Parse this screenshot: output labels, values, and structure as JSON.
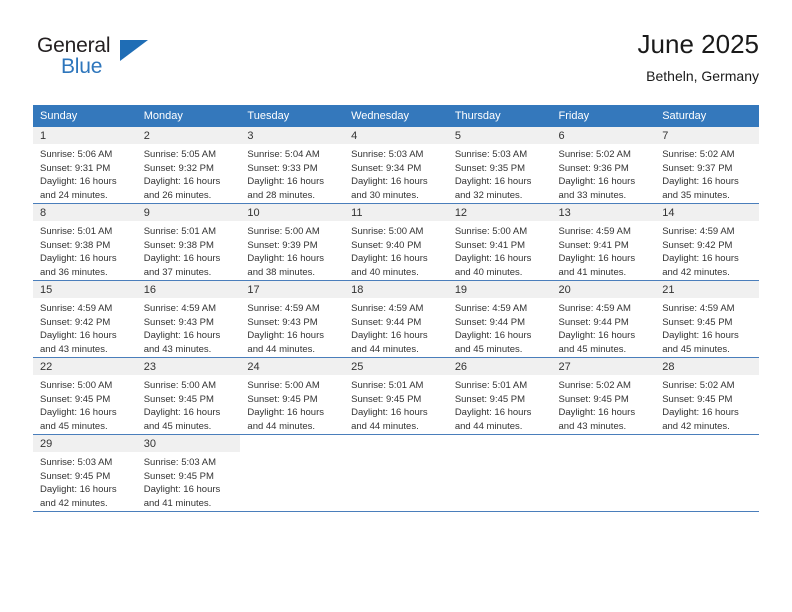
{
  "brand": {
    "word_top": "General",
    "word_bottom": "Blue",
    "triangle_color": "#1F6DB5"
  },
  "header": {
    "title": "June 2025",
    "location": "Betheln, Germany",
    "header_bg_color": "#3478BC",
    "header_text_color": "#FFFFFF"
  },
  "weekday_headers": [
    "Sunday",
    "Monday",
    "Tuesday",
    "Wednesday",
    "Thursday",
    "Friday",
    "Saturday"
  ],
  "weeks": [
    [
      {
        "day": "1",
        "sunrise": "Sunrise: 5:06 AM",
        "sunset": "Sunset: 9:31 PM",
        "daylight_line1": "Daylight: 16 hours",
        "daylight_line2": "and 24 minutes."
      },
      {
        "day": "2",
        "sunrise": "Sunrise: 5:05 AM",
        "sunset": "Sunset: 9:32 PM",
        "daylight_line1": "Daylight: 16 hours",
        "daylight_line2": "and 26 minutes."
      },
      {
        "day": "3",
        "sunrise": "Sunrise: 5:04 AM",
        "sunset": "Sunset: 9:33 PM",
        "daylight_line1": "Daylight: 16 hours",
        "daylight_line2": "and 28 minutes."
      },
      {
        "day": "4",
        "sunrise": "Sunrise: 5:03 AM",
        "sunset": "Sunset: 9:34 PM",
        "daylight_line1": "Daylight: 16 hours",
        "daylight_line2": "and 30 minutes."
      },
      {
        "day": "5",
        "sunrise": "Sunrise: 5:03 AM",
        "sunset": "Sunset: 9:35 PM",
        "daylight_line1": "Daylight: 16 hours",
        "daylight_line2": "and 32 minutes."
      },
      {
        "day": "6",
        "sunrise": "Sunrise: 5:02 AM",
        "sunset": "Sunset: 9:36 PM",
        "daylight_line1": "Daylight: 16 hours",
        "daylight_line2": "and 33 minutes."
      },
      {
        "day": "7",
        "sunrise": "Sunrise: 5:02 AM",
        "sunset": "Sunset: 9:37 PM",
        "daylight_line1": "Daylight: 16 hours",
        "daylight_line2": "and 35 minutes."
      }
    ],
    [
      {
        "day": "8",
        "sunrise": "Sunrise: 5:01 AM",
        "sunset": "Sunset: 9:38 PM",
        "daylight_line1": "Daylight: 16 hours",
        "daylight_line2": "and 36 minutes."
      },
      {
        "day": "9",
        "sunrise": "Sunrise: 5:01 AM",
        "sunset": "Sunset: 9:38 PM",
        "daylight_line1": "Daylight: 16 hours",
        "daylight_line2": "and 37 minutes."
      },
      {
        "day": "10",
        "sunrise": "Sunrise: 5:00 AM",
        "sunset": "Sunset: 9:39 PM",
        "daylight_line1": "Daylight: 16 hours",
        "daylight_line2": "and 38 minutes."
      },
      {
        "day": "11",
        "sunrise": "Sunrise: 5:00 AM",
        "sunset": "Sunset: 9:40 PM",
        "daylight_line1": "Daylight: 16 hours",
        "daylight_line2": "and 40 minutes."
      },
      {
        "day": "12",
        "sunrise": "Sunrise: 5:00 AM",
        "sunset": "Sunset: 9:41 PM",
        "daylight_line1": "Daylight: 16 hours",
        "daylight_line2": "and 40 minutes."
      },
      {
        "day": "13",
        "sunrise": "Sunrise: 4:59 AM",
        "sunset": "Sunset: 9:41 PM",
        "daylight_line1": "Daylight: 16 hours",
        "daylight_line2": "and 41 minutes."
      },
      {
        "day": "14",
        "sunrise": "Sunrise: 4:59 AM",
        "sunset": "Sunset: 9:42 PM",
        "daylight_line1": "Daylight: 16 hours",
        "daylight_line2": "and 42 minutes."
      }
    ],
    [
      {
        "day": "15",
        "sunrise": "Sunrise: 4:59 AM",
        "sunset": "Sunset: 9:42 PM",
        "daylight_line1": "Daylight: 16 hours",
        "daylight_line2": "and 43 minutes."
      },
      {
        "day": "16",
        "sunrise": "Sunrise: 4:59 AM",
        "sunset": "Sunset: 9:43 PM",
        "daylight_line1": "Daylight: 16 hours",
        "daylight_line2": "and 43 minutes."
      },
      {
        "day": "17",
        "sunrise": "Sunrise: 4:59 AM",
        "sunset": "Sunset: 9:43 PM",
        "daylight_line1": "Daylight: 16 hours",
        "daylight_line2": "and 44 minutes."
      },
      {
        "day": "18",
        "sunrise": "Sunrise: 4:59 AM",
        "sunset": "Sunset: 9:44 PM",
        "daylight_line1": "Daylight: 16 hours",
        "daylight_line2": "and 44 minutes."
      },
      {
        "day": "19",
        "sunrise": "Sunrise: 4:59 AM",
        "sunset": "Sunset: 9:44 PM",
        "daylight_line1": "Daylight: 16 hours",
        "daylight_line2": "and 45 minutes."
      },
      {
        "day": "20",
        "sunrise": "Sunrise: 4:59 AM",
        "sunset": "Sunset: 9:44 PM",
        "daylight_line1": "Daylight: 16 hours",
        "daylight_line2": "and 45 minutes."
      },
      {
        "day": "21",
        "sunrise": "Sunrise: 4:59 AM",
        "sunset": "Sunset: 9:45 PM",
        "daylight_line1": "Daylight: 16 hours",
        "daylight_line2": "and 45 minutes."
      }
    ],
    [
      {
        "day": "22",
        "sunrise": "Sunrise: 5:00 AM",
        "sunset": "Sunset: 9:45 PM",
        "daylight_line1": "Daylight: 16 hours",
        "daylight_line2": "and 45 minutes."
      },
      {
        "day": "23",
        "sunrise": "Sunrise: 5:00 AM",
        "sunset": "Sunset: 9:45 PM",
        "daylight_line1": "Daylight: 16 hours",
        "daylight_line2": "and 45 minutes."
      },
      {
        "day": "24",
        "sunrise": "Sunrise: 5:00 AM",
        "sunset": "Sunset: 9:45 PM",
        "daylight_line1": "Daylight: 16 hours",
        "daylight_line2": "and 44 minutes."
      },
      {
        "day": "25",
        "sunrise": "Sunrise: 5:01 AM",
        "sunset": "Sunset: 9:45 PM",
        "daylight_line1": "Daylight: 16 hours",
        "daylight_line2": "and 44 minutes."
      },
      {
        "day": "26",
        "sunrise": "Sunrise: 5:01 AM",
        "sunset": "Sunset: 9:45 PM",
        "daylight_line1": "Daylight: 16 hours",
        "daylight_line2": "and 44 minutes."
      },
      {
        "day": "27",
        "sunrise": "Sunrise: 5:02 AM",
        "sunset": "Sunset: 9:45 PM",
        "daylight_line1": "Daylight: 16 hours",
        "daylight_line2": "and 43 minutes."
      },
      {
        "day": "28",
        "sunrise": "Sunrise: 5:02 AM",
        "sunset": "Sunset: 9:45 PM",
        "daylight_line1": "Daylight: 16 hours",
        "daylight_line2": "and 42 minutes."
      }
    ],
    [
      {
        "day": "29",
        "sunrise": "Sunrise: 5:03 AM",
        "sunset": "Sunset: 9:45 PM",
        "daylight_line1": "Daylight: 16 hours",
        "daylight_line2": "and 42 minutes."
      },
      {
        "day": "30",
        "sunrise": "Sunrise: 5:03 AM",
        "sunset": "Sunset: 9:45 PM",
        "daylight_line1": "Daylight: 16 hours",
        "daylight_line2": "and 41 minutes."
      },
      {
        "day": "",
        "sunrise": "",
        "sunset": "",
        "daylight_line1": "",
        "daylight_line2": ""
      },
      {
        "day": "",
        "sunrise": "",
        "sunset": "",
        "daylight_line1": "",
        "daylight_line2": ""
      },
      {
        "day": "",
        "sunrise": "",
        "sunset": "",
        "daylight_line1": "",
        "daylight_line2": ""
      },
      {
        "day": "",
        "sunrise": "",
        "sunset": "",
        "daylight_line1": "",
        "daylight_line2": ""
      },
      {
        "day": "",
        "sunrise": "",
        "sunset": "",
        "daylight_line1": "",
        "daylight_line2": ""
      }
    ]
  ]
}
